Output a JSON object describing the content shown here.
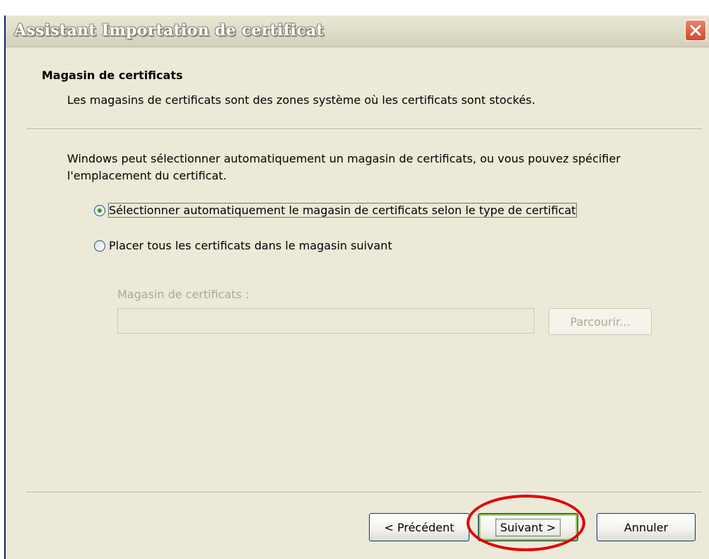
{
  "window": {
    "title": "Assistant Importation de certificat",
    "close_icon": "close-icon"
  },
  "header": {
    "section_title": "Magasin de certificats",
    "section_description": "Les magasins de certificats sont des zones système où les certificats sont stockés."
  },
  "body": {
    "intro": "Windows peut sélectionner automatiquement un magasin de certificats, ou vous pouvez spécifier l'emplacement du certificat.",
    "options": [
      {
        "label": "Sélectionner automatiquement le magasin de certificats selon le type de certificat",
        "checked": true
      },
      {
        "label": "Placer tous les certificats dans le magasin suivant",
        "checked": false
      }
    ],
    "store_label": "Magasin de certificats :",
    "store_value": "",
    "browse_label": "Parcourir..."
  },
  "footer": {
    "back_label": "< Précédent",
    "next_label": "Suivant >",
    "cancel_label": "Annuler"
  },
  "colors": {
    "dialog_bg": "#ece9d8",
    "highlight": "#e00000",
    "close_red": "#d4482a"
  }
}
